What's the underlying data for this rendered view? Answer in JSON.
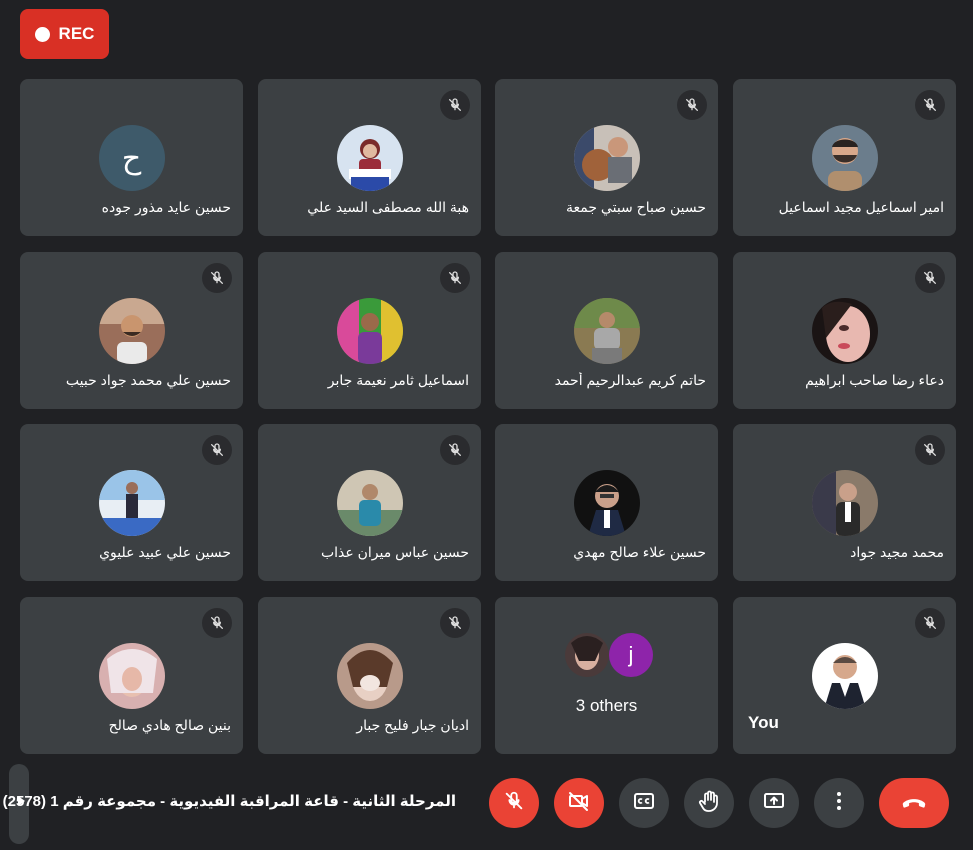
{
  "recording": {
    "label": "REC"
  },
  "participants": [
    {
      "name": "امير اسماعيل مجيد اسماعيل"
    },
    {
      "name": "حسين صباح سبتي جمعة"
    },
    {
      "name": "هبة الله مصطفى السيد علي"
    },
    {
      "name": "حسين عايد مذور جوده",
      "initial": "ح"
    },
    {
      "name": "دعاء رضا صاحب ابراهيم"
    },
    {
      "name": "حاتم كريم عبدالرحيم أحمد"
    },
    {
      "name": "اسماعيل ثامر نعيمة جابر"
    },
    {
      "name": "حسين علي محمد جواد حبيب"
    },
    {
      "name": "محمد مجيد جواد"
    },
    {
      "name": "حسين علاء صالح مهدي"
    },
    {
      "name": "حسين عباس ميران عذاب"
    },
    {
      "name": "حسين علي عبيد عليوي"
    },
    {
      "name": "اديان جبار فليح جبار"
    },
    {
      "name": "بنين صالح هادي صالح"
    }
  ],
  "others": {
    "label": "3 others",
    "initial": "j"
  },
  "self": {
    "label": "You"
  },
  "meeting": {
    "title": "المرحلة الثانية - قاعة المراقبة الفيديوية - مجموعة رقم 1 (2578)"
  },
  "controls": {
    "mic": "mic-off-icon",
    "camera": "camera-off-icon",
    "captions": "closed-captions-icon",
    "hand": "raise-hand-icon",
    "present": "present-screen-icon",
    "more": "more-options-icon",
    "leave": "leave-call-icon"
  },
  "colors": {
    "background": "#202124",
    "tile": "#3c4043",
    "accent_red": "#ea4335",
    "rec_red": "#d93025",
    "others_avatar": "#8e24aa"
  }
}
